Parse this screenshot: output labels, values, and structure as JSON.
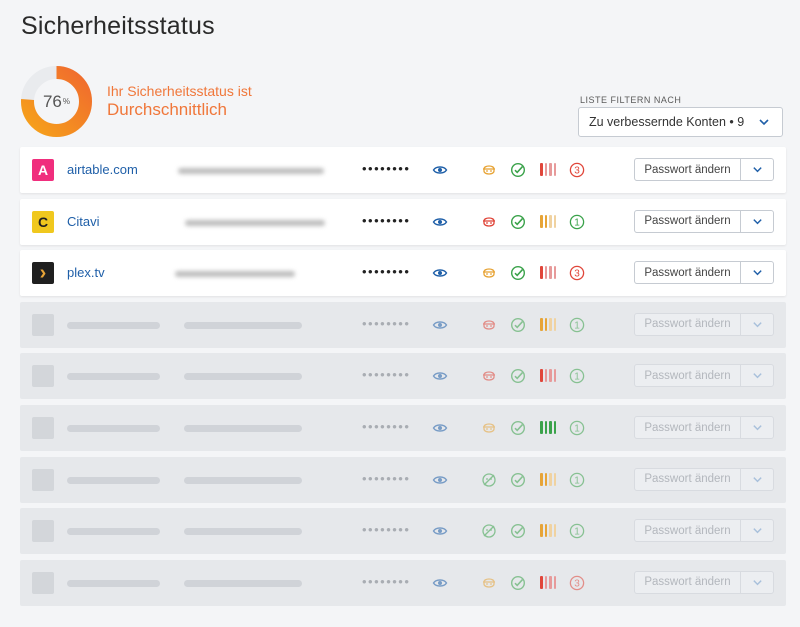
{
  "page": {
    "title": "Sicherheitsstatus"
  },
  "score": {
    "value": "76",
    "unit": "%",
    "fraction": 0.76,
    "line1": "Ihr Sicherheitsstatus ist",
    "line2": "Durchschnittlich"
  },
  "filter": {
    "label": "LISTE FILTERN NACH",
    "selected": "Zu verbessernde Konten • 9"
  },
  "colors": {
    "accent": "#f0773a",
    "link": "#1f5fa8",
    "warn": "#e7a437",
    "danger": "#e0463a",
    "ok": "#3aa24a"
  },
  "rows": [
    {
      "ghost": false,
      "logo_letter": "A",
      "logo_color": "#f02e7d",
      "domain": "airtable.com",
      "password_mask": "••••••••",
      "face": "orange",
      "check": "green",
      "strength": "weak",
      "count": "3",
      "count_color": "red",
      "button": "Passwort ändern"
    },
    {
      "ghost": false,
      "logo_letter": "C",
      "logo_color": "#f0c81e",
      "domain": "Citavi",
      "password_mask": "••••••••",
      "face": "red",
      "check": "green",
      "strength": "medium",
      "count": "1",
      "count_color": "green",
      "button": "Passwort ändern"
    },
    {
      "ghost": false,
      "logo_letter": "›",
      "logo_color": "#1f1f1f",
      "domain": "plex.tv",
      "password_mask": "••••••••",
      "face": "orange",
      "check": "green",
      "strength": "weak",
      "count": "3",
      "count_color": "red",
      "button": "Passwort ändern"
    },
    {
      "ghost": true,
      "password_mask": "••••••••",
      "face": "red",
      "check": "green",
      "strength": "medium",
      "count": "1",
      "count_color": "green",
      "button": "Passwort ändern"
    },
    {
      "ghost": true,
      "password_mask": "••••••••",
      "face": "red",
      "check": "green",
      "strength": "weak",
      "count": "1",
      "count_color": "green",
      "button": "Passwort ändern"
    },
    {
      "ghost": true,
      "password_mask": "••••••••",
      "face": "orange",
      "check": "green",
      "strength": "strong",
      "count": "1",
      "count_color": "green",
      "button": "Passwort ändern"
    },
    {
      "ghost": true,
      "password_mask": "••••••••",
      "face": "crossed",
      "check": "green",
      "strength": "medium",
      "count": "1",
      "count_color": "green",
      "button": "Passwort ändern"
    },
    {
      "ghost": true,
      "password_mask": "••••••••",
      "face": "crossed",
      "check": "green",
      "strength": "medium",
      "count": "1",
      "count_color": "green",
      "button": "Passwort ändern"
    },
    {
      "ghost": true,
      "password_mask": "••••••••",
      "face": "orange",
      "check": "green",
      "strength": "weak",
      "count": "3",
      "count_color": "red",
      "button": "Passwort ändern"
    }
  ]
}
